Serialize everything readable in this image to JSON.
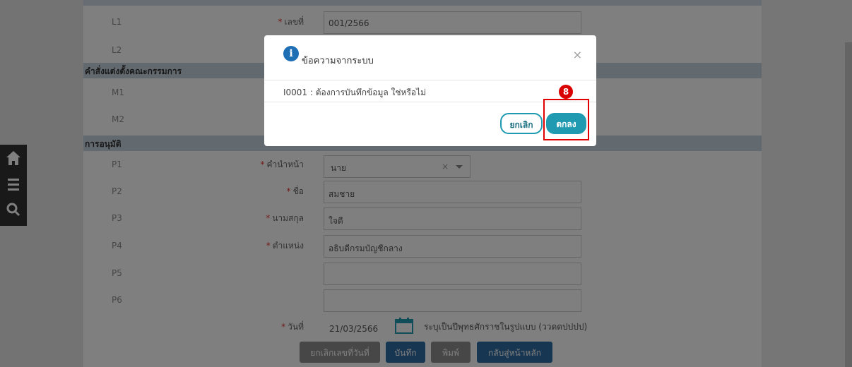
{
  "form": {
    "rows_a": [
      {
        "code": "L1",
        "label": "เลขที่",
        "required": true,
        "value": "001/2566"
      },
      {
        "code": "L2"
      }
    ],
    "section_committee": "คำสั่งแต่งตั้งคณะกรรมการ",
    "rows_m": [
      {
        "code": "M1"
      },
      {
        "code": "M2"
      }
    ],
    "section_approval": "การอนุมัติ",
    "p1": {
      "code": "P1",
      "label": "คำนำหน้า",
      "value": "นาย",
      "clear": "×"
    },
    "p2": {
      "code": "P2",
      "label": "ชื่อ",
      "value": "สมชาย"
    },
    "p3": {
      "code": "P3",
      "label": "นามสกุล",
      "value": "ใจดี"
    },
    "p4": {
      "code": "P4",
      "label": "ตำแหน่ง",
      "value": "อธิบดีกรมบัญชีกลาง"
    },
    "p5": {
      "code": "P5",
      "value": ""
    },
    "p6": {
      "code": "P6",
      "value": ""
    },
    "date": {
      "label": "วันที่",
      "value": "21/03/2566",
      "hint": "ระบุเป็นปีพุทธศักราชในรูปแบบ (ววดดปปปป)",
      "icon": "calendar-icon"
    },
    "required_mark": "*"
  },
  "actions": {
    "cancel_number_date": "ยกเลิกเลขที่วันที่",
    "save": "บันทึก",
    "print": "พิมพ์",
    "back_home": "กลับสู่หน้าหลัก"
  },
  "sidebar": {
    "icons": [
      "home-icon",
      "menu-icon",
      "search-icon"
    ]
  },
  "modal": {
    "title": "ข้อความจากระบบ",
    "info_icon": "i",
    "close": "×",
    "message": "I0001 : ต้องการบันทึกข้อมูล ใช่หรือไม่",
    "cancel_label": "ยกเลิก",
    "ok_label": "ตกลง"
  },
  "annotation": {
    "step": "8",
    "color": "#e00000"
  },
  "colors": {
    "section": "#c5d3df",
    "primary": "#1f9ab0",
    "required": "#e53935"
  }
}
